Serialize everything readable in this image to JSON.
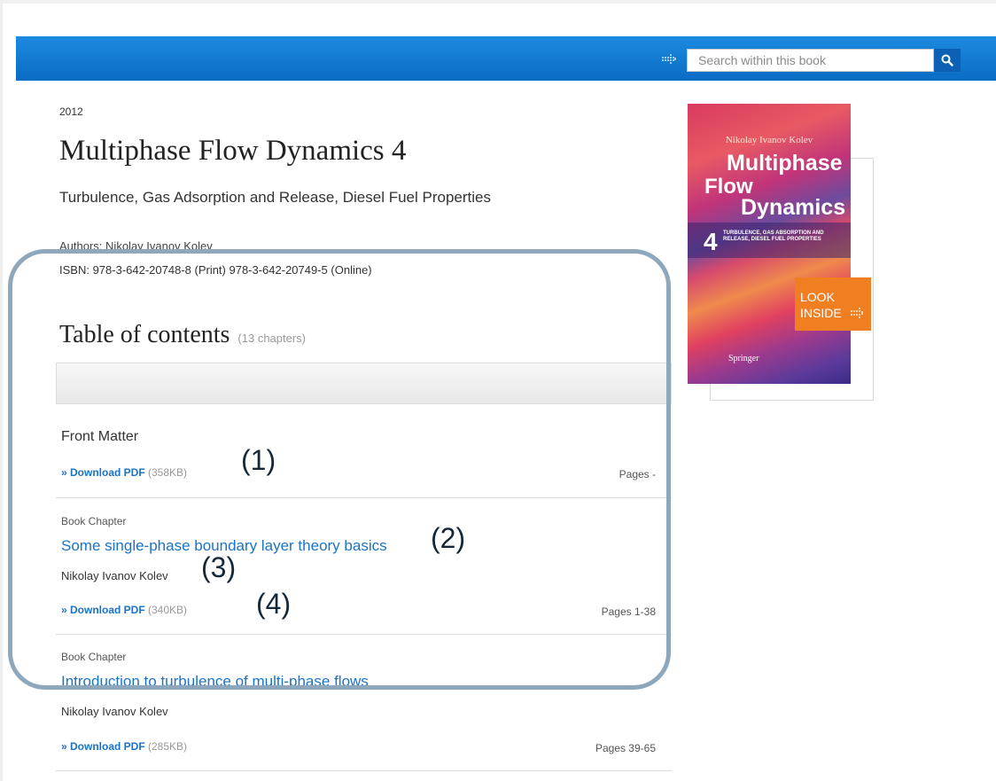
{
  "search": {
    "placeholder": "Search within this book"
  },
  "book": {
    "year": "2012",
    "title": "Multiphase Flow Dynamics 4",
    "subtitle": "Turbulence, Gas Adsorption and Release, Diesel Fuel Properties",
    "authors_label": "Authors:",
    "author": "Nikolay Ivanov Kolev",
    "isbn": "ISBN: 978-3-642-20748-8 (Print) 978-3-642-20749-5 (Online)"
  },
  "cover": {
    "author": "Nikolay Ivanov Kolev",
    "title_line1": "Multiphase",
    "title_line2": "Flow",
    "title_line3": "Dynamics",
    "number": "4",
    "subtitle": "TURBULENCE, GAS ABSORPTION AND RELEASE, DIESEL FUEL PROPERTIES",
    "publisher": "Springer",
    "look_inside_line1": "LOOK",
    "look_inside_line2": "INSIDE"
  },
  "toc": {
    "title": "Table of contents",
    "count": "(13 chapters)",
    "entries": [
      {
        "type": "",
        "title": "Front Matter",
        "author": "",
        "download": "» Download PDF",
        "size": "(358KB)",
        "pages": "Pages -"
      },
      {
        "type": "Book Chapter",
        "title": "Some single-phase boundary layer theory basics",
        "author": "Nikolay Ivanov Kolev",
        "download": "» Download PDF",
        "size": "(340KB)",
        "pages": "Pages 1-38"
      },
      {
        "type": "Book Chapter",
        "title": "Introduction to turbulence of multi-phase flows",
        "author": "Nikolay Ivanov Kolev",
        "download": "» Download PDF",
        "size": "(285KB)",
        "pages": "Pages 39-65"
      }
    ]
  },
  "annotations": [
    "(1)",
    "(2)",
    "(3)",
    "(4)"
  ]
}
